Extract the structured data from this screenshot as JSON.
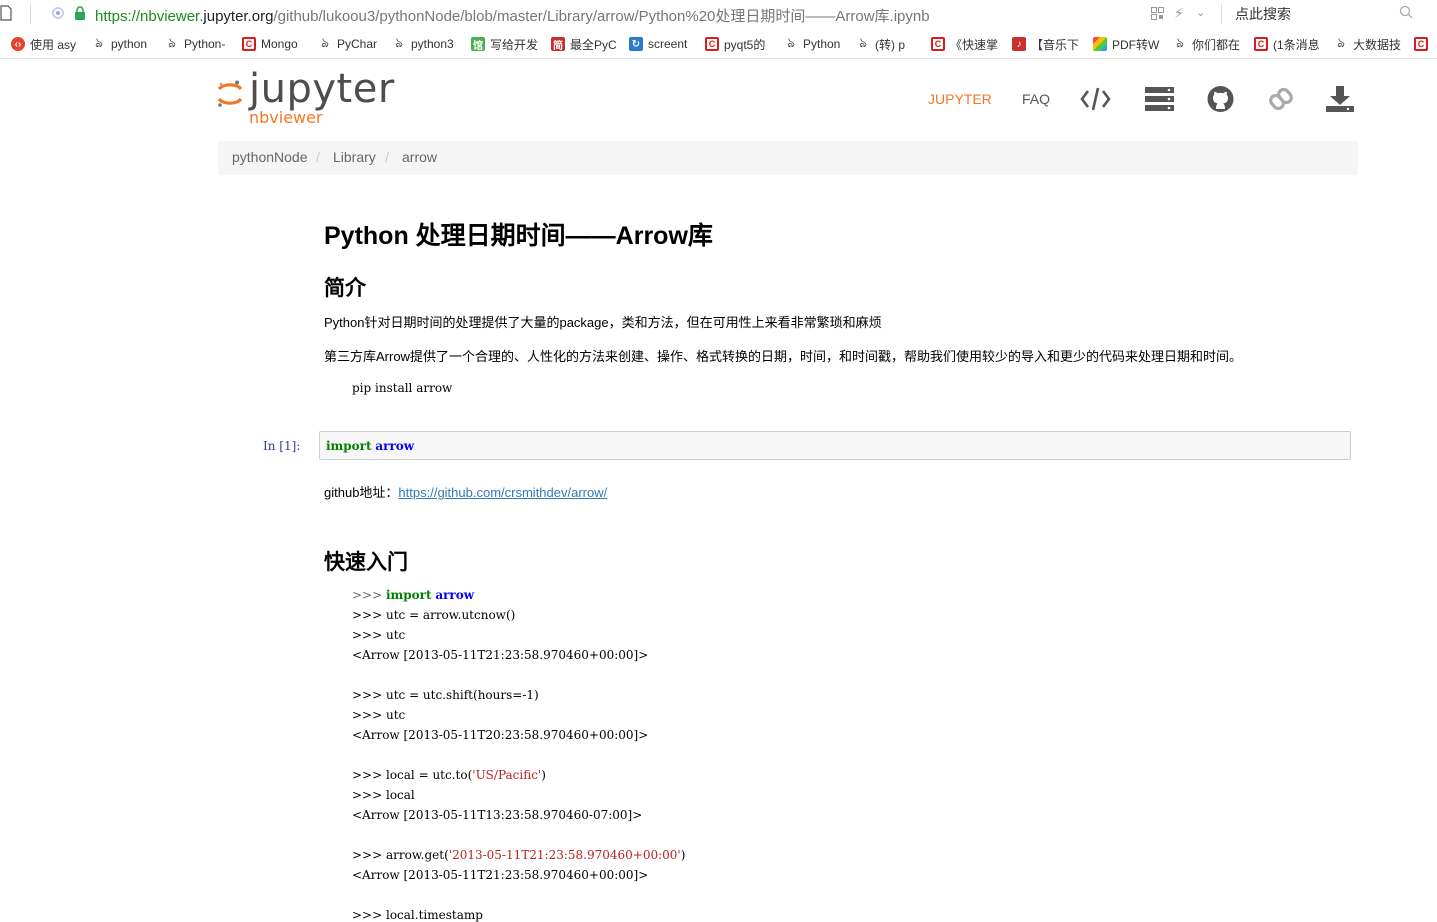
{
  "browser": {
    "url_scheme": "https://nbviewer.",
    "url_domain": "jupyter.org",
    "url_path": "/github/lukoou3/pythonNode/blob/master/Library/arrow/Python%20处理日期时间——Arrow库.ipynb",
    "search_placeholder": "点此搜索"
  },
  "bookmarks": [
    {
      "label": "使用 asy",
      "icon": "red-round-icon"
    },
    {
      "label": "python",
      "icon": "python-icon"
    },
    {
      "label": "Python-",
      "icon": "python-icon"
    },
    {
      "label": "Mongo",
      "icon": "csdn-icon"
    },
    {
      "label": "PyChar",
      "icon": "python-icon"
    },
    {
      "label": "python3",
      "icon": "python-icon"
    },
    {
      "label": "写给开发",
      "icon": "green-icon"
    },
    {
      "label": "最全PyC",
      "icon": "red-square-icon"
    },
    {
      "label": "screent",
      "icon": "blue-icon"
    },
    {
      "label": "pyqt5的",
      "icon": "csdn-icon"
    },
    {
      "label": "Python",
      "icon": "python-icon"
    },
    {
      "label": "(转) p",
      "icon": "python-icon"
    },
    {
      "label": "《快速掌",
      "icon": "csdn-icon"
    },
    {
      "label": "【音乐下",
      "icon": "red-square-icon"
    },
    {
      "label": "PDF转W",
      "icon": "multi-icon"
    },
    {
      "label": "你们都在",
      "icon": "python-icon"
    },
    {
      "label": "(1条消息",
      "icon": "csdn-icon"
    },
    {
      "label": "大数据技",
      "icon": "python-icon"
    },
    {
      "label": "",
      "icon": "csdn-icon"
    }
  ],
  "header": {
    "logo_word": "jupyter",
    "logo_sub": "nbviewer",
    "nav_jupyter": "JUPYTER",
    "nav_faq": "FAQ",
    "accent": "#f37726"
  },
  "breadcrumb": [
    "pythonNode",
    "Library",
    "arrow"
  ],
  "notebook": {
    "title": "Python 处理日期时间——Arrow库",
    "intro_heading": "简介",
    "intro_p1": "Python针对日期时间的处理提供了大量的package，类和方法，但在可用性上来看非常繁琐和麻烦",
    "intro_p2": "第三方库Arrow提供了一个合理的、人性化的方法来创建、操作、格式转换的日期，时间，和时间戳，帮助我们使用较少的导入和更少的代码来处理日期和时间。",
    "install_cmd": "pip install arrow",
    "cell_prompt": "In [1]:",
    "cell_kw": "import",
    "cell_mod": "arrow",
    "github_label": "github地址：",
    "github_link": "https://github.com/crsmithdev/arrow/",
    "quickstart_heading": "快速入门",
    "code": {
      "l1_prompt": ">>> ",
      "l1_kw": "import",
      "l1_mod": "arrow",
      "l2": ">>> utc = arrow.utcnow()",
      "l3": ">>> utc",
      "l4": "<Arrow [2013-05-11T21:23:58.970460+00:00]>",
      "l5": ">>> utc = utc.shift(hours=-1)",
      "l6": ">>> utc",
      "l7": "<Arrow [2013-05-11T20:23:58.970460+00:00]>",
      "l8_pre": ">>> local = utc.to(",
      "l8_str": "'US/Pacific'",
      "l8_post": ")",
      "l9": ">>> local",
      "l10": "<Arrow [2013-05-11T13:23:58.970460-07:00]>",
      "l11_pre": ">>> arrow.get(",
      "l11_str": "'2013-05-11T21:23:58.970460+00:00'",
      "l11_post": ")",
      "l12": "<Arrow [2013-05-11T21:23:58.970460+00:00]>",
      "l13": ">>> local.timestamp"
    }
  }
}
